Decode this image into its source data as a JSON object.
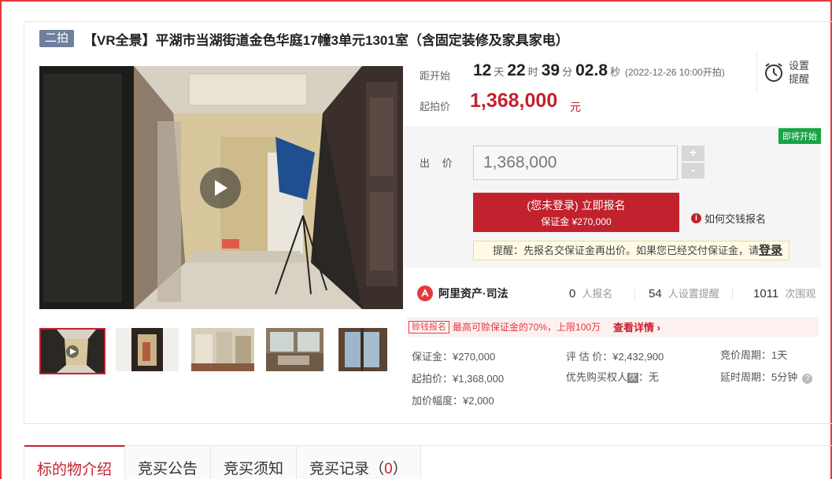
{
  "listing": {
    "badge": "二拍",
    "title": "【VR全景】平湖市当湖街道金色华庭17幢3单元1301室（含固定装修及家具家电）"
  },
  "countdown": {
    "label": "距开始",
    "days": "12",
    "days_unit": "天",
    "hours": "22",
    "hours_unit": "时",
    "minutes": "39",
    "minutes_unit": "分",
    "seconds": "02.8",
    "seconds_unit": "秒",
    "start_time": "(2022-12-26 10:00开拍)"
  },
  "start_price": {
    "label": "起拍价",
    "value": "1,368,000",
    "unit": "元"
  },
  "remind": {
    "label_line1": "设置",
    "label_line2": "提醒"
  },
  "bid": {
    "status_badge": "即将开始",
    "label": "出 价",
    "input_value": "1,368,000",
    "plus": "+",
    "minus": "-",
    "signup_main": "(您未登录) 立即报名",
    "signup_sub": "保证金 ¥270,000",
    "howto": "如何交钱报名",
    "hint_text": "提醒：先报名交保证金再出价。如果您已经交付保证金，请",
    "hint_link": "登录"
  },
  "platform": {
    "brand": "阿里资产·司法",
    "signups_num": "0",
    "signups_label": "人报名",
    "reminders_num": "54",
    "reminders_label": "人设置提醒",
    "views_num": "1011",
    "views_label": "次围观"
  },
  "loan": {
    "tag": "赊钱报名",
    "text": "最高可赊保证金的70%，上限100万",
    "link": "查看详情 ›"
  },
  "details": {
    "deposit": "保证金：¥270,000",
    "appraisal": "评 估 价：¥2,432,900",
    "cycle": "竞价周期：1天",
    "start_price": "起拍价：¥1,368,000",
    "priority_label": "优先购买权人",
    "priority_tag": "优",
    "priority_value": "：无",
    "delay": "延时周期：5分钟",
    "increment": "加价幅度：¥2,000"
  },
  "tabs": [
    {
      "label": "标的物介绍"
    },
    {
      "label": "竞买公告"
    },
    {
      "label": "竞买须知"
    },
    {
      "label": "竞买记录",
      "count_open": "（",
      "count": "0",
      "count_close": "）"
    }
  ],
  "colors": {
    "accent": "#c2222e",
    "green_badge": "#19a446",
    "badge_gray": "#6f7f9e"
  }
}
